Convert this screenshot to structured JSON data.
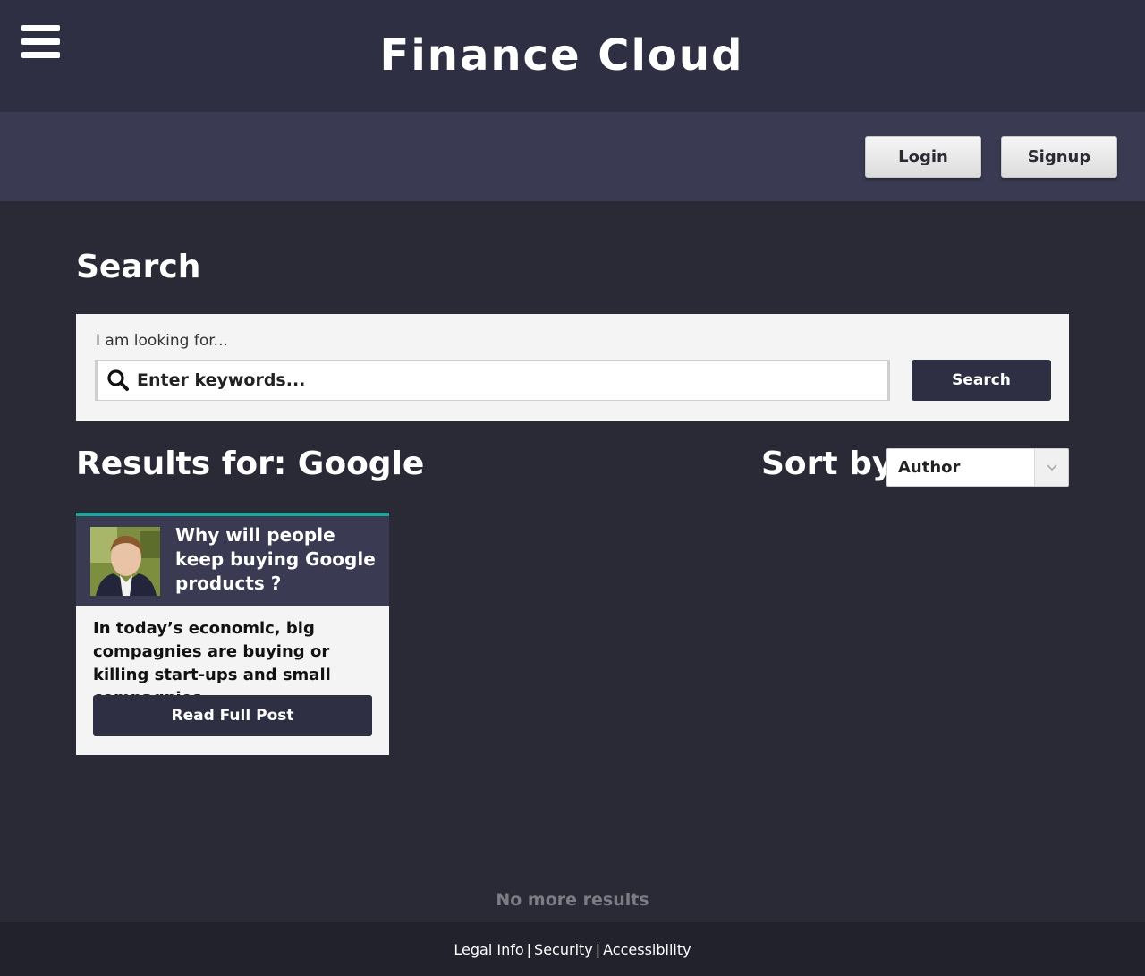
{
  "header": {
    "menu_icon": "hamburger-menu-icon",
    "title": "Finance Cloud"
  },
  "auth": {
    "login_label": "Login",
    "signup_label": "Signup"
  },
  "search": {
    "heading": "Search",
    "label": "I am looking for...",
    "placeholder": "Enter keywords...",
    "search_icon": "search-icon",
    "button_label": "Search"
  },
  "results": {
    "heading": "Results for: Google",
    "sort_label": "Sort by",
    "sort_value": "Author",
    "items": [
      {
        "title": "Why will people keep buying Google products ?",
        "excerpt": "In today’s economic, big compagnies are buying or killing start-ups and small compagnies.",
        "button_label": "Read Full Post",
        "accent_color": "#1fa59a"
      }
    ],
    "end_text": "No more results"
  },
  "footer": {
    "links": [
      "Legal Info",
      "Security",
      "Accessibility"
    ],
    "separator": "|"
  },
  "colors": {
    "primary": "#2e2f42",
    "accent": "#1fa59a",
    "background": "#2a2a36"
  }
}
